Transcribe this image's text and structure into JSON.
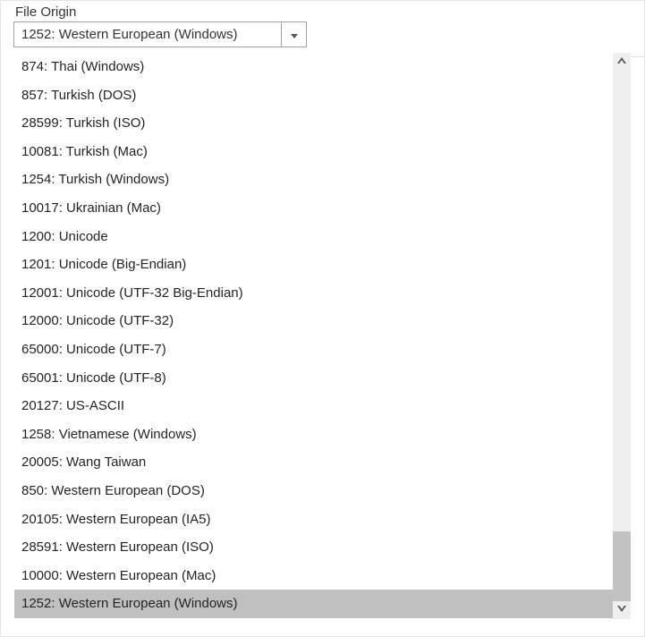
{
  "field": {
    "label": "File Origin",
    "selected_value": "1252: Western European (Windows)"
  },
  "options": [
    {
      "label": "874: Thai (Windows)",
      "selected": false
    },
    {
      "label": "857: Turkish (DOS)",
      "selected": false
    },
    {
      "label": "28599: Turkish (ISO)",
      "selected": false
    },
    {
      "label": "10081: Turkish (Mac)",
      "selected": false
    },
    {
      "label": "1254: Turkish (Windows)",
      "selected": false
    },
    {
      "label": "10017: Ukrainian (Mac)",
      "selected": false
    },
    {
      "label": "1200: Unicode",
      "selected": false
    },
    {
      "label": "1201: Unicode (Big-Endian)",
      "selected": false
    },
    {
      "label": "12001: Unicode (UTF-32 Big-Endian)",
      "selected": false
    },
    {
      "label": "12000: Unicode (UTF-32)",
      "selected": false
    },
    {
      "label": "65000: Unicode (UTF-7)",
      "selected": false
    },
    {
      "label": "65001: Unicode (UTF-8)",
      "selected": false
    },
    {
      "label": "20127: US-ASCII",
      "selected": false
    },
    {
      "label": "1258: Vietnamese (Windows)",
      "selected": false
    },
    {
      "label": "20005: Wang Taiwan",
      "selected": false
    },
    {
      "label": "850: Western European (DOS)",
      "selected": false
    },
    {
      "label": "20105: Western European (IA5)",
      "selected": false
    },
    {
      "label": "28591: Western European (ISO)",
      "selected": false
    },
    {
      "label": "10000: Western European (Mac)",
      "selected": false
    },
    {
      "label": "1252: Western European (Windows)",
      "selected": true
    }
  ]
}
